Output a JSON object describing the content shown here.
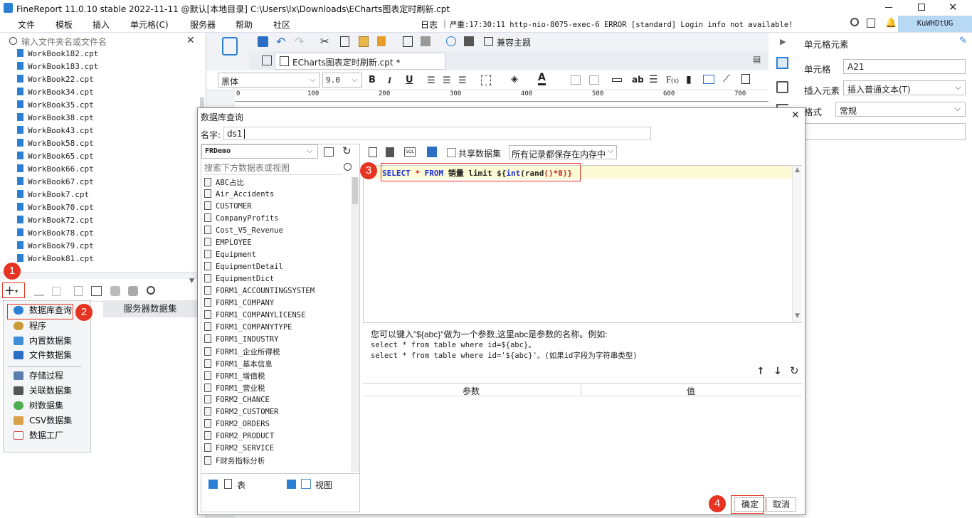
{
  "app": {
    "title": "FineReport 11.0.10 stable 2022-11-11 @默认[本地目录]",
    "filepath": "C:\\Users\\lx\\Downloads\\ECharts图表定时刷新.cpt"
  },
  "menu": [
    "文件",
    "模板",
    "插入",
    "单元格(C)",
    "服务器",
    "帮助",
    "社区"
  ],
  "log": {
    "label": "日志",
    "sep": "|",
    "text": "严重:17:30:11 http-nio-8075-exec-6 ERROR [standard] Login info not available!",
    "user": "KuWHDtUG"
  },
  "left": {
    "search_placeholder": "输入文件夹名或文件名",
    "files": [
      "WorkBook182.cpt",
      "WorkBook183.cpt",
      "WorkBook22.cpt",
      "WorkBook34.cpt",
      "WorkBook35.cpt",
      "WorkBook38.cpt",
      "WorkBook43.cpt",
      "WorkBook58.cpt",
      "WorkBook65.cpt",
      "WorkBook66.cpt",
      "WorkBook67.cpt",
      "WorkBook7.cpt",
      "WorkBook70.cpt",
      "WorkBook72.cpt",
      "WorkBook78.cpt",
      "WorkBook79.cpt",
      "WorkBook81.cpt"
    ],
    "server_dataset": "服务器数据集",
    "popup_items": [
      "数据库查询",
      "程序",
      "内置数据集",
      "文件数据集",
      "存储过程",
      "关联数据集",
      "树数据集",
      "CSV数据集",
      "数据工厂"
    ],
    "popup_colors": [
      "#2b7fd4",
      "#c89a3a",
      "#3f8fd8",
      "#2b6fc4",
      "#5a7fae",
      "#555555",
      "#4caf50",
      "#d8a24a",
      "#d04a4a"
    ]
  },
  "toolbar": {
    "compat_theme": "兼容主题",
    "tab_title": "ECharts图表定时刷新.cpt *",
    "font_name": "黑体",
    "font_size": "9.0",
    "ruler": [
      "0",
      "100",
      "200",
      "300",
      "400",
      "500",
      "600",
      "700"
    ]
  },
  "right": {
    "title": "单元格元素",
    "cell_label": "单元格",
    "cell_value": "A21",
    "insert_label": "插入元素",
    "insert_value": "插入普通文本(T)",
    "format_label": "格式",
    "format_value": "常规"
  },
  "dialog": {
    "title": "数据库查询",
    "name_label": "名字:",
    "name_value": "ds1",
    "connection": "FRDemo",
    "search_placeholder": "搜索下方数据表或视图",
    "tables": [
      "ABC占比",
      "Air_Accidents",
      "CUSTOMER",
      "CompanyProfits",
      "Cost_VS_Revenue",
      "EMPLOYEE",
      "Equipment",
      "EquipmentDetail",
      "EquipmentDict",
      "FORM1_ACCOUNTINGSYSTEM",
      "FORM1_COMPANY",
      "FORM1_COMPANYLICENSE",
      "FORM1_COMPANYTYPE",
      "FORM1_INDUSTRY",
      "FORM1_企业所得税",
      "FORM1_基本信息",
      "FORM1_增值税",
      "FORM1_营业税",
      "FORM2_CHANCE",
      "FORM2_CUSTOMER",
      "FORM2_ORDERS",
      "FORM2_PRODUCT",
      "FORM2_SERVICE",
      "F财务指标分析"
    ],
    "show_table": "表",
    "show_view": "视图",
    "shared_dataset": "共享数据集",
    "memory_option": "所有记录都保存在内存中",
    "sql_keyword_select": "SELECT",
    "sql_star": "*",
    "sql_keyword_from": "FROM",
    "sql_rest": "销量 limit ${",
    "sql_func_int": "int",
    "sql_paren_open": "(",
    "sql_func_rand": "rand",
    "sql_tail": "()*8)}",
    "hint_line1": "您可以键入\"${abc}\"做为一个参数,这里abc是参数的名称。例如:",
    "hint_line2": "select * from table where id=${abc}。",
    "hint_line3": "select * from table where id='${abc}'。(如果id字段为字符串类型)",
    "col_param": "参数",
    "col_value": "值",
    "ok": "确定",
    "cancel": "取消"
  },
  "badges": [
    "1",
    "2",
    "3",
    "4"
  ]
}
